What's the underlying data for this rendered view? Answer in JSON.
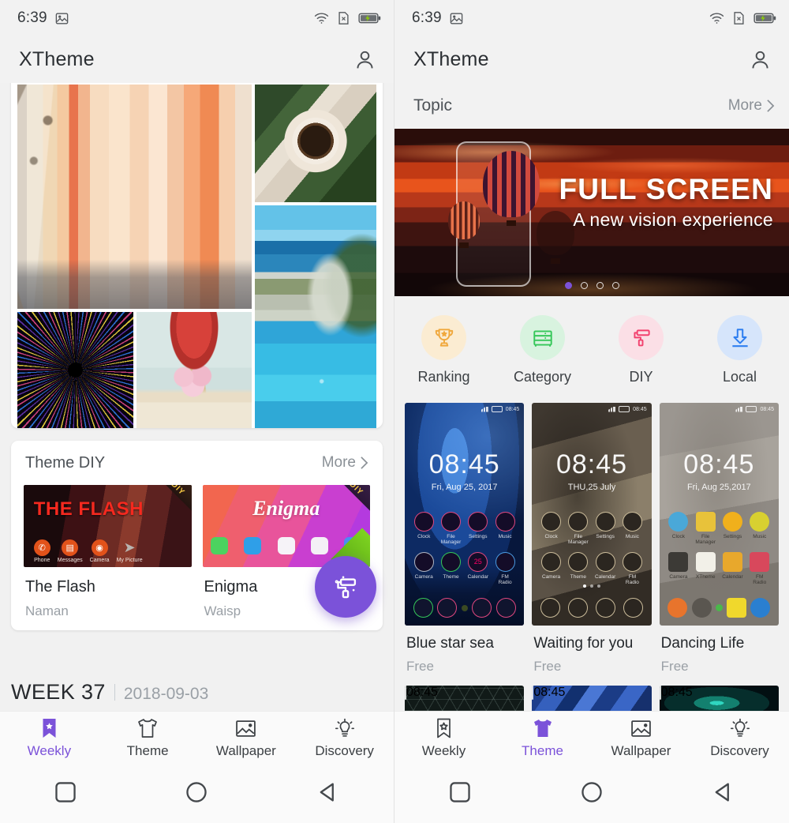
{
  "left": {
    "statusbar": {
      "time": "6:39",
      "icons": [
        "image-icon",
        "wifi-icon",
        "no-sim-icon",
        "battery-charging-icon"
      ]
    },
    "titlebar": {
      "app_title": "XTheme",
      "avatar_icon": "account-icon"
    },
    "collage": {
      "photos": [
        {
          "name": "colorful-mediterranean-street"
        },
        {
          "name": "coffee-cup-with-leaves"
        },
        {
          "name": "navagio-beach-blue-sea"
        },
        {
          "name": "ferris-wheel-light-trails"
        },
        {
          "name": "pink-macarons-jar"
        }
      ]
    },
    "theme_diy": {
      "title": "Theme DIY",
      "more_label": "More",
      "items": [
        {
          "title": "THE FLASH",
          "name": "The Flash",
          "author": "Naman",
          "badge": "DIY",
          "app_labels": [
            "Phone",
            "Messages",
            "Camera",
            "My Picture"
          ]
        },
        {
          "title": "Enigma",
          "name": "Enigma",
          "author": "Waisp",
          "badge": "DIY"
        }
      ]
    },
    "fab": {
      "icon": "paint-roller-icon",
      "color": "#7b52d9"
    },
    "week": {
      "number": "WEEK 37",
      "date": "2018-09-03"
    },
    "tabs": [
      {
        "label": "Weekly",
        "icon": "bookmark-star-icon",
        "active": true
      },
      {
        "label": "Theme",
        "icon": "tshirt-icon",
        "active": false
      },
      {
        "label": "Wallpaper",
        "icon": "image-icon",
        "active": false
      },
      {
        "label": "Discovery",
        "icon": "lightbulb-icon",
        "active": false
      }
    ]
  },
  "right": {
    "statusbar": {
      "time": "6:39",
      "icons": [
        "image-icon",
        "wifi-icon",
        "no-sim-icon",
        "battery-charging-icon"
      ]
    },
    "titlebar": {
      "app_title": "XTheme",
      "avatar_icon": "account-icon"
    },
    "topic": {
      "title": "Topic",
      "more_label": "More",
      "banner": {
        "headline": "FULL SCREEN",
        "subhead": "A new vision experience",
        "scene": "sunset-hot-air-balloons-cityscape",
        "dots_total": 4,
        "dot_active": 1
      }
    },
    "quick_actions": [
      {
        "label": "Ranking",
        "icon": "trophy-icon",
        "icon_color": "#f0a83c",
        "bg": "#fbecd2"
      },
      {
        "label": "Category",
        "icon": "drawer-grid-icon",
        "icon_color": "#35c759",
        "bg": "#d8f3df"
      },
      {
        "label": "DIY",
        "icon": "paint-roller-icon",
        "icon_color": "#f2416e",
        "bg": "#fbdfe6"
      },
      {
        "label": "Local",
        "icon": "download-icon",
        "icon_color": "#2f7ff0",
        "bg": "#d6e5fb"
      }
    ],
    "themes": [
      {
        "name": "Blue star sea",
        "price": "Free",
        "clock": "08:45",
        "date": "Fri, Aug 25, 2017",
        "app_labels": [
          "Clock",
          "File Manager",
          "Settings",
          "Music",
          "Camera",
          "Theme",
          "Calendar",
          "FM Radio"
        ]
      },
      {
        "name": "Waiting for you",
        "price": "Free",
        "clock": "08:45",
        "date": "THU,25 July",
        "app_labels": [
          "Clock",
          "File Manager",
          "Settings",
          "Music",
          "Camera",
          "Theme",
          "Calendar",
          "FM Radio"
        ]
      },
      {
        "name": "Dancing Life",
        "price": "Free",
        "clock": "08:45",
        "date": "Fri, Aug 25,2017",
        "app_labels": [
          "Clock",
          "File Manager",
          "Settings",
          "Music",
          "Camera",
          "XTheme",
          "Calendar",
          "FM Radio"
        ]
      }
    ],
    "themes_next_row": [
      {
        "name": "hexagon-dark-theme"
      },
      {
        "name": "blue-polygon-theme"
      },
      {
        "name": "teal-nebula-theme"
      }
    ],
    "tabs": [
      {
        "label": "Weekly",
        "icon": "bookmark-star-icon",
        "active": false
      },
      {
        "label": "Theme",
        "icon": "tshirt-icon",
        "active": true
      },
      {
        "label": "Wallpaper",
        "icon": "image-icon",
        "active": false
      },
      {
        "label": "Discovery",
        "icon": "lightbulb-icon",
        "active": false
      }
    ]
  },
  "navbar": {
    "buttons": [
      "recents-square-icon",
      "home-circle-icon",
      "back-triangle-icon"
    ]
  }
}
